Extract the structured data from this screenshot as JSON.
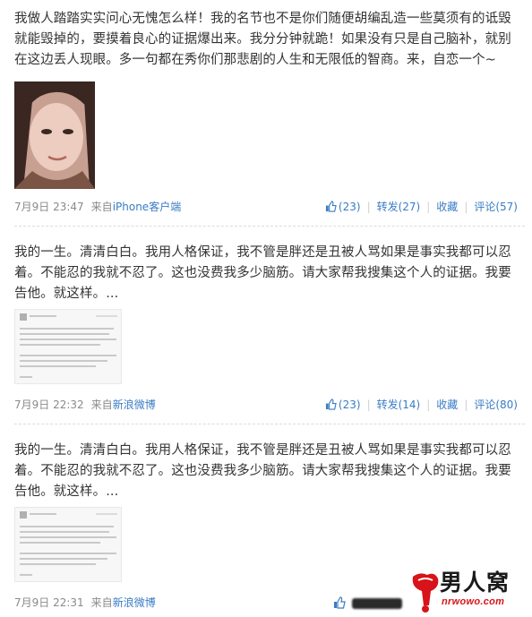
{
  "posts": [
    {
      "text": "我做人踏踏实实问心无愧怎么样！我的名节也不是你们随便胡编乱造一些莫须有的诋毁就能毁掉的，要摸着良心的证据爆出来。我分分钟就跪！如果没有只是自己脑补，就别在这边丢人现眼。多一句都在秀你们那悲剧的人生和无限低的智商。来，自恋一个~",
      "time": "7月9日 23:47",
      "from_prefix": "来自",
      "source": "iPhone客户端",
      "like_count": "(23)",
      "repost": "转发(27)",
      "favorite": "收藏",
      "comment": "评论(57)"
    },
    {
      "text": "我的一生。清清白白。我用人格保证，我不管是胖还是丑被人骂如果是事实我都可以忍着。不能忍的我就不忍了。这也没费我多少脑筋。请大家帮我搜集这个人的证据。我要告他。就这样。...",
      "time": "7月9日 22:32",
      "from_prefix": "来自",
      "source": "新浪微博",
      "like_count": "(23)",
      "repost": "转发(14)",
      "favorite": "收藏",
      "comment": "评论(80)"
    },
    {
      "text": "我的一生。清清白白。我用人格保证，我不管是胖还是丑被人骂如果是事实我都可以忍着。不能忍的我就不忍了。这也没费我多少脑筋。请大家帮我搜集这个人的证据。我要告他。就这样。...",
      "time": "7月9日 22:31",
      "from_prefix": "来自",
      "source": "新浪微博"
    }
  ],
  "watermark": {
    "brand": "男人窝",
    "url": "nrwowo.com"
  },
  "colors": {
    "link": "#3a7cc4",
    "meta": "#8a8a8a",
    "logo_red": "#d8131a"
  }
}
